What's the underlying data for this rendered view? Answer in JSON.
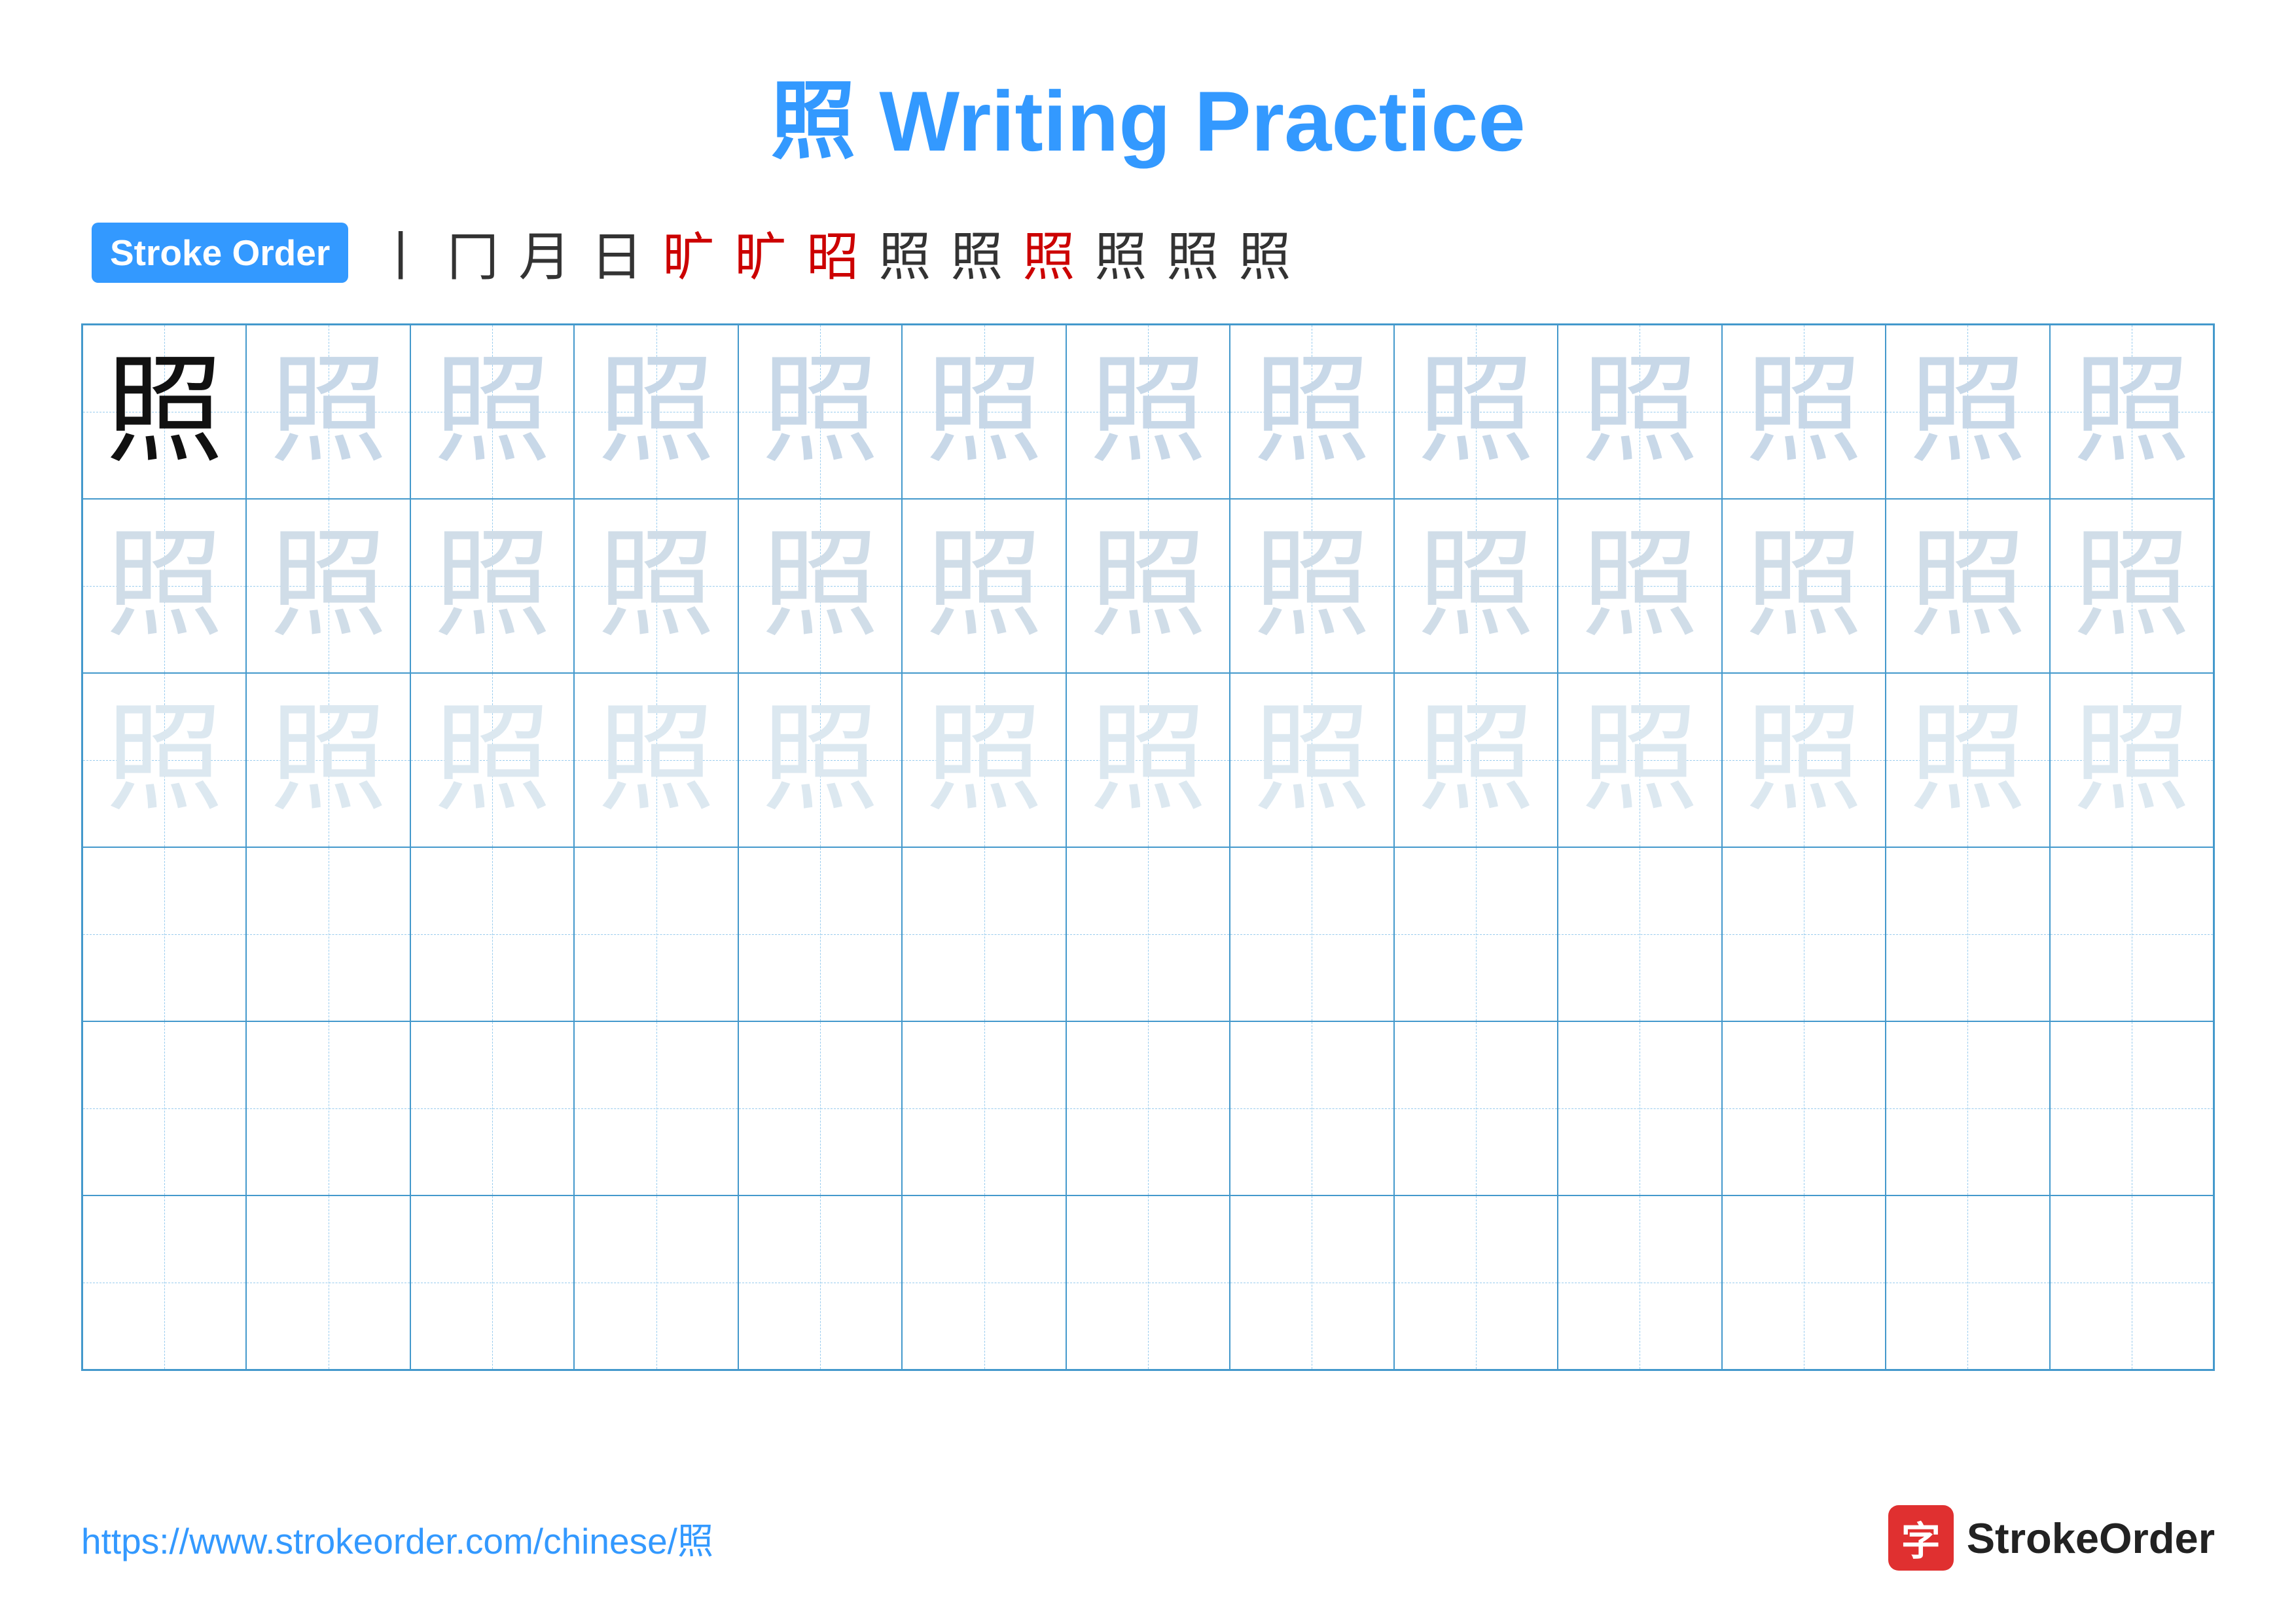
{
  "title": "照 Writing Practice",
  "stroke_order": {
    "label": "Stroke Order",
    "strokes": [
      "丨",
      "冂",
      "月",
      "日",
      "昭",
      "昭",
      "昭",
      "照",
      "照",
      "照",
      "照",
      "照",
      "照"
    ]
  },
  "character": "照",
  "grid": {
    "rows": 6,
    "cols": 13,
    "filled_rows": 3
  },
  "footer": {
    "url": "https://www.strokeorder.com/chinese/照",
    "logo_char": "字",
    "logo_text": "StrokeOrder"
  }
}
